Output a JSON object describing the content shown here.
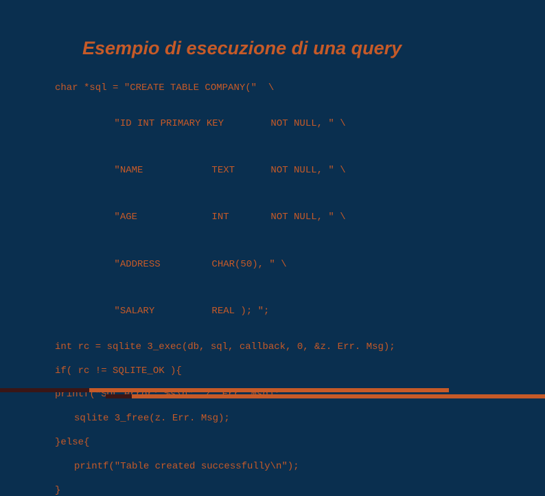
{
  "title": "Esempio di esecuzione di una query",
  "code": {
    "l1": "char *sql = \"CREATE TABLE COMPANY(\"  \\",
    "l2a": "\"ID INT PRIMARY KEY",
    "l2b": "",
    "l2c": "NOT NULL, \" \\",
    "l3a": "\"NAME",
    "l3b": "TEXT",
    "l3c": "NOT NULL, \" \\",
    "l4a": "\"AGE",
    "l4b": "INT",
    "l4c": "NOT NULL, \" \\",
    "l5a": "\"ADDRESS",
    "l5b": "CHAR(50), \" \\",
    "l6a": "\"SALARY",
    "l6b": "REAL ); \";",
    "l7": "int rc = sqlite 3_exec(db, sql, callback, 0, &z. Err. Msg);",
    "l8": "if( rc != SQLITE_OK ){",
    "l9": "printf(\"SQL error: %s\\n\", z. Err. Msg);",
    "l10": "sqlite 3_free(z. Err. Msg);",
    "l11": "}else{",
    "l12": "printf(\"Table created successfully\\n\");",
    "l13": "}"
  }
}
